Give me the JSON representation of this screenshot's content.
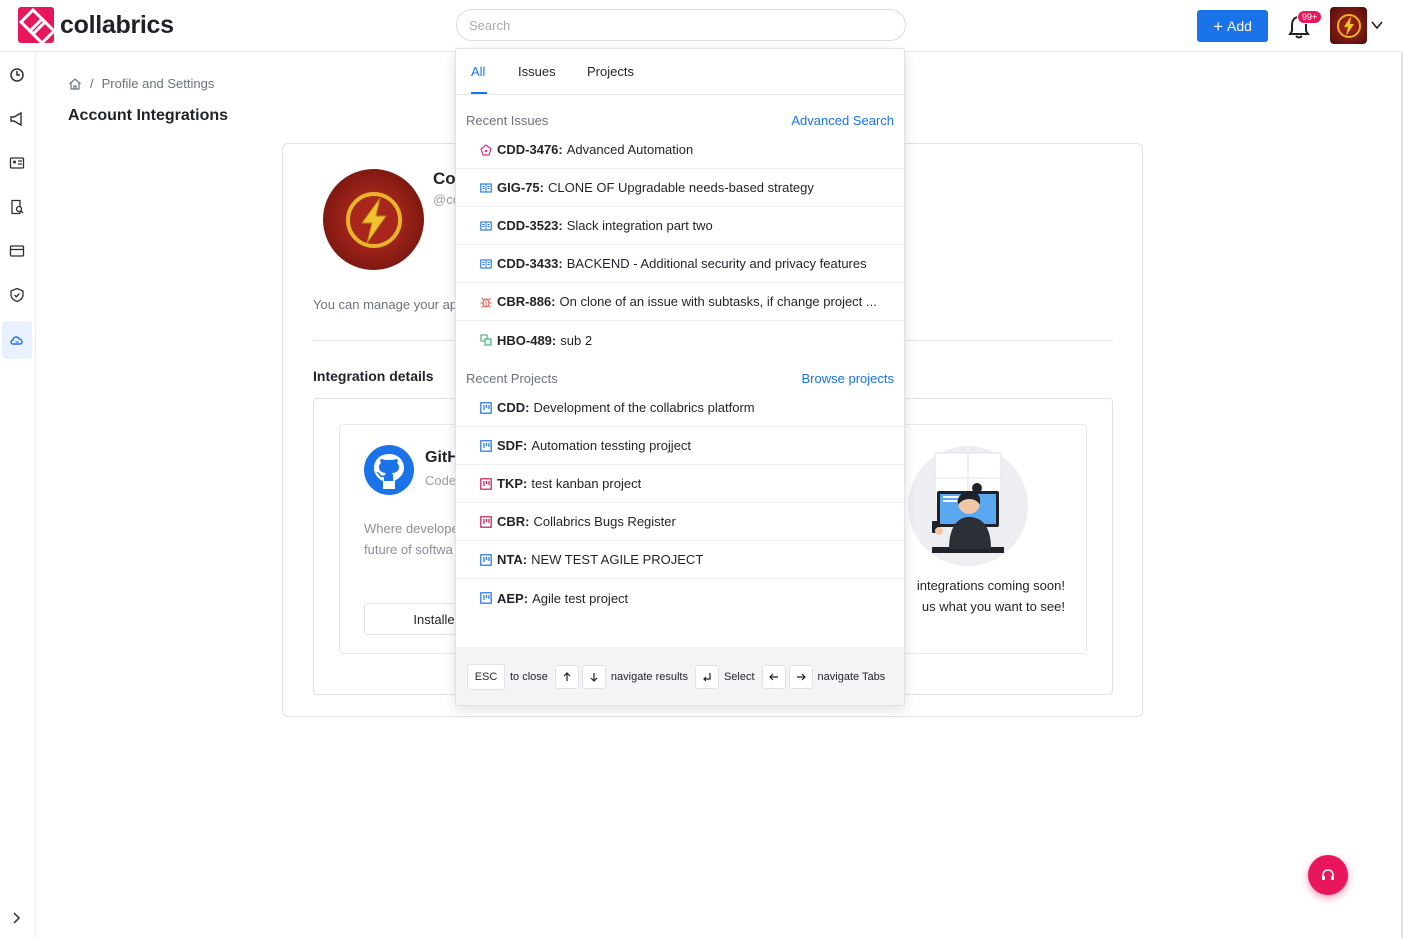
{
  "app": {
    "name": "collabrics"
  },
  "search": {
    "placeholder": "Search"
  },
  "header": {
    "add_label": "Add",
    "notification_count": "99+"
  },
  "breadcrumb": {
    "current": "Profile and Settings"
  },
  "page": {
    "title": "Account Integrations"
  },
  "account": {
    "name": "Co",
    "handle": "@cc",
    "manage_text": "You can manage your ap"
  },
  "integrations": {
    "title": "Integration details",
    "github": {
      "name": "GitH",
      "subtitle": "Code",
      "desc_line1": "Where develope",
      "desc_line2": "future of softwa",
      "button": "Installe"
    },
    "coming_soon": {
      "line1": "integrations coming soon!",
      "line2": "us what you want to see!"
    }
  },
  "dropdown": {
    "tabs": [
      {
        "label": "All"
      },
      {
        "label": "Issues"
      },
      {
        "label": "Projects"
      }
    ],
    "recent_issues_label": "Recent Issues",
    "advanced_search": "Advanced Search",
    "issues": [
      {
        "key": "CDD-3476:",
        "title": "Advanced Automation",
        "type": "epic"
      },
      {
        "key": "GIG-75:",
        "title": "CLONE OF Upgradable needs-based strategy",
        "type": "story"
      },
      {
        "key": "CDD-3523:",
        "title": "Slack integration part two",
        "type": "story"
      },
      {
        "key": "CDD-3433:",
        "title": "BACKEND - Additional security and privacy features",
        "type": "story"
      },
      {
        "key": "CBR-886:",
        "title": "On clone of an issue with subtasks, if change project ...",
        "type": "bug"
      },
      {
        "key": "HBO-489:",
        "title": "sub 2",
        "type": "subtask"
      }
    ],
    "recent_projects_label": "Recent Projects",
    "browse_projects": "Browse projects",
    "projects": [
      {
        "key": "CDD:",
        "title": "Development of the collabrics platform",
        "color": "#1a73e8"
      },
      {
        "key": "SDF:",
        "title": "Automation tessting projject",
        "color": "#1a73e8"
      },
      {
        "key": "TKP:",
        "title": "test kanban project",
        "color": "#c2185b"
      },
      {
        "key": "CBR:",
        "title": "Collabrics Bugs Register",
        "color": "#c2185b"
      },
      {
        "key": "NTA:",
        "title": "NEW TEST AGILE PROJECT",
        "color": "#1a73e8"
      },
      {
        "key": "AEP:",
        "title": "Agile test project",
        "color": "#1a73e8"
      }
    ],
    "footer": {
      "esc": "ESC",
      "to_close": "to close",
      "navigate_results": "navigate results",
      "select": "Select",
      "navigate_tabs": "navigate Tabs"
    }
  },
  "colors": {
    "brand": "#e8175d",
    "accent": "#1a73e8"
  }
}
